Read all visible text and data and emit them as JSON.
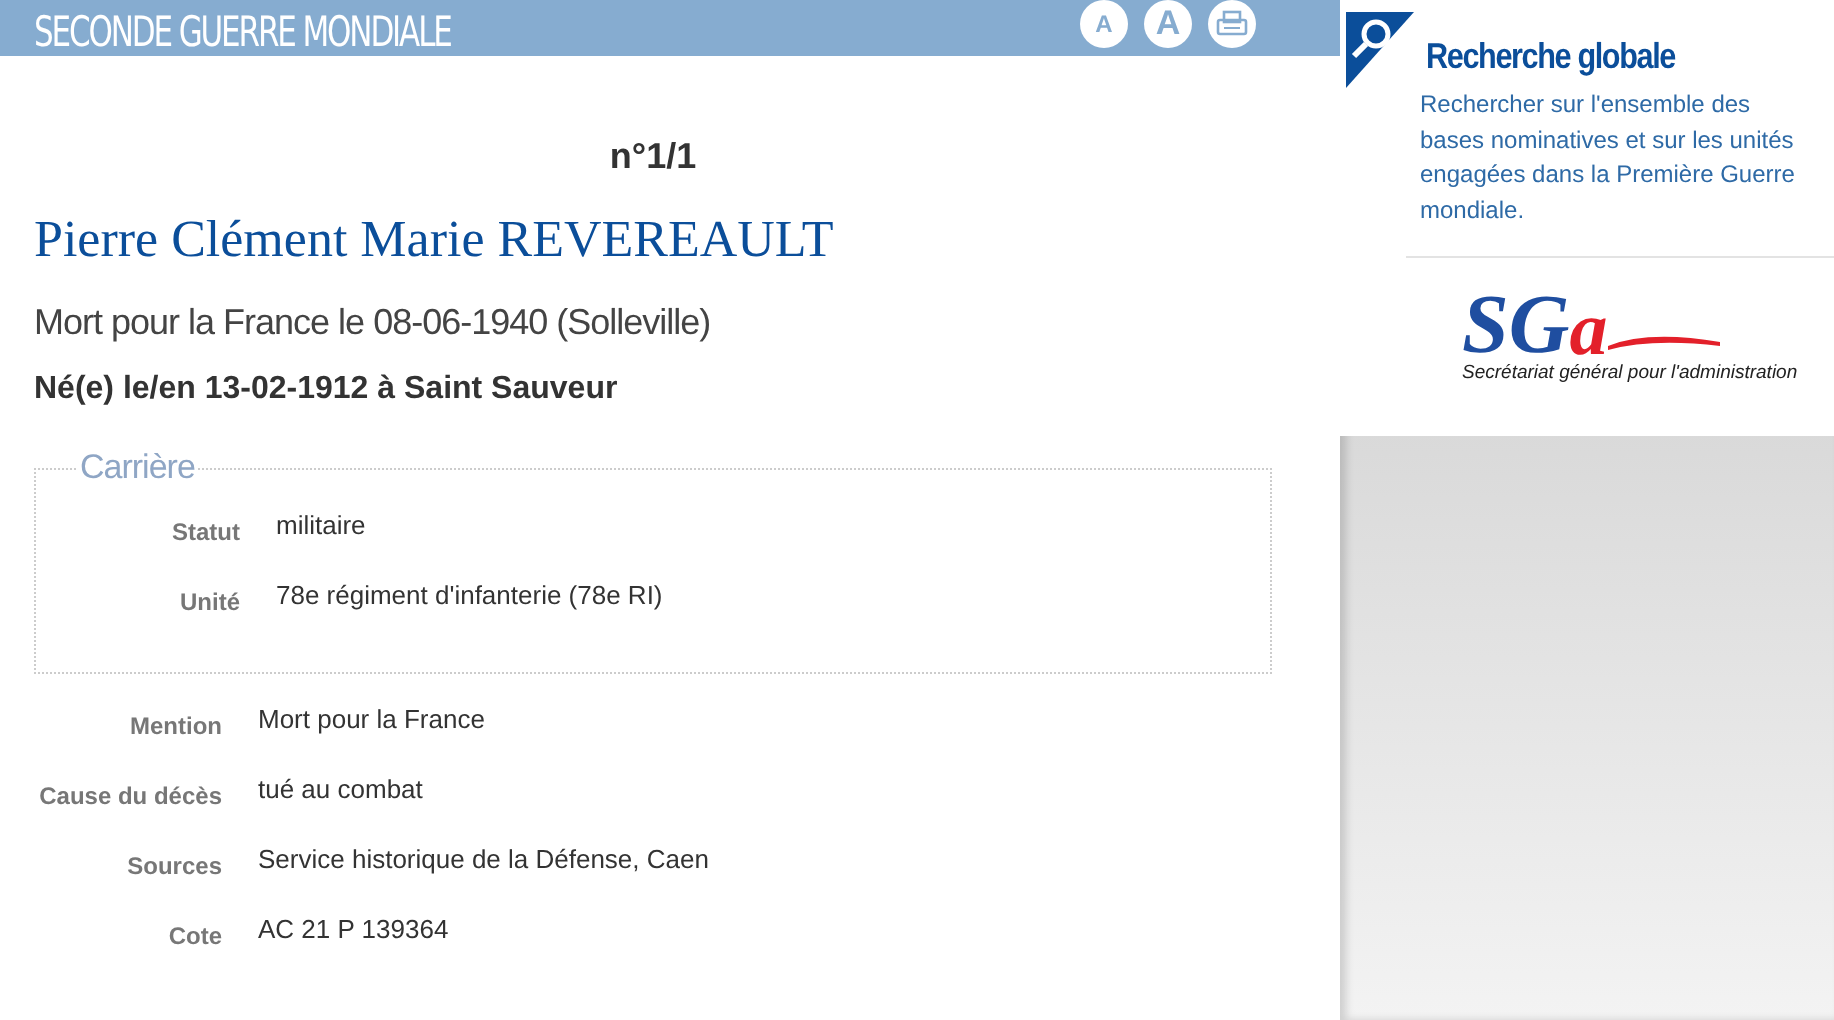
{
  "header": {
    "title": "SECONDE GUERRE MONDIALE",
    "tools": [
      {
        "kind": "font-smaller",
        "label": "A"
      },
      {
        "kind": "font-larger",
        "label": "A"
      },
      {
        "kind": "print"
      }
    ]
  },
  "record": {
    "number": "n°1/1",
    "name": "Pierre Clément Marie REVEREAULT",
    "death": "Mort pour la France le 08-06-1940 (Solleville)",
    "birth": "Né(e) le/en 13-02-1912 à Saint Sauveur",
    "career": {
      "legend": "Carrière",
      "fields": [
        {
          "label": "Statut",
          "value": "militaire"
        },
        {
          "label": "Unité",
          "value": "78e régiment d'infanterie (78e RI)"
        }
      ]
    },
    "fields": [
      {
        "label": "Mention",
        "value": "Mort pour la France"
      },
      {
        "label": "Cause du décès",
        "value": "tué au combat"
      },
      {
        "label": "Sources",
        "value": "Service historique de la Défense, Caen"
      },
      {
        "label": "Cote",
        "value": "AC 21 P 139364"
      }
    ]
  },
  "sidebar": {
    "search": {
      "title": "Recherche globale",
      "text": "Rechercher sur l'ensemble des bases nominatives et sur les unités engagées dans la Première Guerre mondiale."
    },
    "logo": {
      "mark": "SG",
      "letter": "a",
      "tagline": "Secrétariat général pour l'administration"
    }
  }
}
